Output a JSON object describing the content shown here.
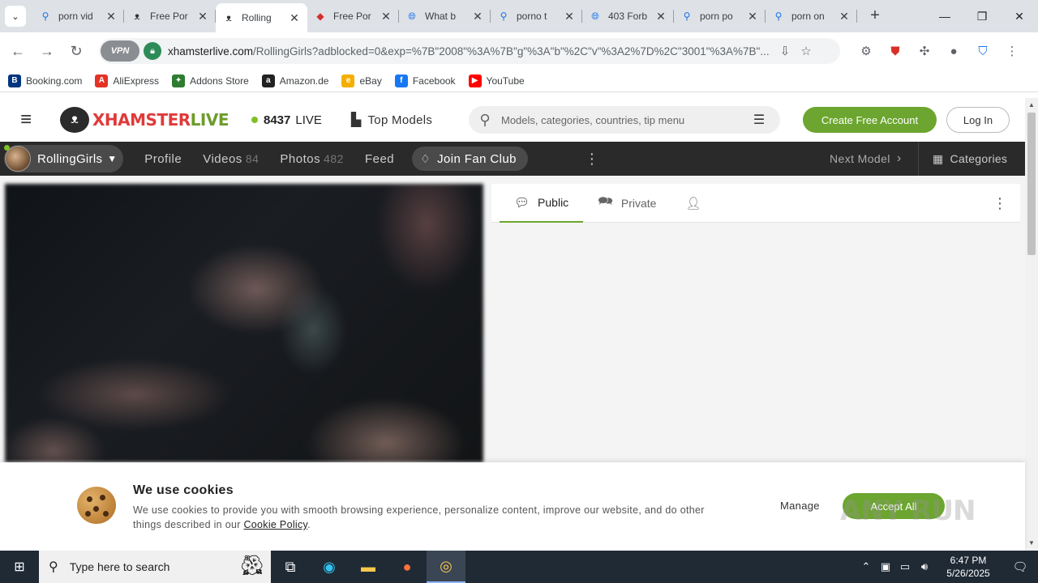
{
  "browser": {
    "tabs": [
      {
        "title": "porn vid",
        "icon": "search-icon",
        "active": false
      },
      {
        "title": "Free Por",
        "icon": "hamster-icon",
        "active": false
      },
      {
        "title": "Rolling",
        "icon": "hamster-icon",
        "active": true
      },
      {
        "title": "Free Por",
        "icon": "red-logo-icon",
        "active": false
      },
      {
        "title": "What b",
        "icon": "globe-icon",
        "active": false
      },
      {
        "title": "porno t",
        "icon": "search-icon",
        "active": false
      },
      {
        "title": "403 Forb",
        "icon": "globe-icon",
        "active": false
      },
      {
        "title": "porn po",
        "icon": "search-icon",
        "active": false
      },
      {
        "title": "porn on",
        "icon": "search-icon",
        "active": false
      }
    ],
    "vpn_label": "VPN",
    "url_domain": "xhamsterlive.com",
    "url_path": "/RollingGirls?adblocked=0&exp=%7B\"2008\"%3A%7B\"g\"%3A\"b\"%2C\"v\"%3A2%7D%2C\"3001\"%3A%7B\"...",
    "bookmarks": [
      {
        "label": "Booking.com",
        "icon": "B",
        "color": "#003580"
      },
      {
        "label": "AliExpress",
        "icon": "A",
        "color": "#e43225"
      },
      {
        "label": "Addons Store",
        "icon": "✦",
        "color": "#2e7d32"
      },
      {
        "label": "Amazon.de",
        "icon": "a",
        "color": "#222222"
      },
      {
        "label": "eBay",
        "icon": "e",
        "color": "#f5af02"
      },
      {
        "label": "Facebook",
        "icon": "f",
        "color": "#1877f2"
      },
      {
        "label": "YouTube",
        "icon": "▶",
        "color": "#ff0000"
      }
    ]
  },
  "site": {
    "logo_x": "XHAMSTER",
    "logo_live": "LIVE",
    "live_count": "8437",
    "live_label": "LIVE",
    "top_models": "Top Models",
    "search_placeholder": "Models, categories, countries, tip menu",
    "create_account": "Create Free Account",
    "login": "Log In",
    "accent": "#6ca52f"
  },
  "model_nav": {
    "model_name": "RollingGirls",
    "profile": "Profile",
    "videos": "Videos",
    "videos_count": "84",
    "photos": "Photos",
    "photos_count": "482",
    "feed": "Feed",
    "fan_club": "Join Fan Club",
    "next_model": "Next Model",
    "categories": "Categories"
  },
  "chat": {
    "public": "Public",
    "private": "Private"
  },
  "cookie": {
    "title": "We use cookies",
    "text": "We use cookies to provide you with smooth browsing experience, personalize content, improve our website, and do other things described in our",
    "policy_link": "Cookie Policy",
    "manage": "Manage",
    "accept": "Accept All",
    "watermark": "ANY RUN"
  },
  "taskbar": {
    "search_placeholder": "Type here to search",
    "time": "6:47 PM",
    "date": "5/26/2025"
  }
}
